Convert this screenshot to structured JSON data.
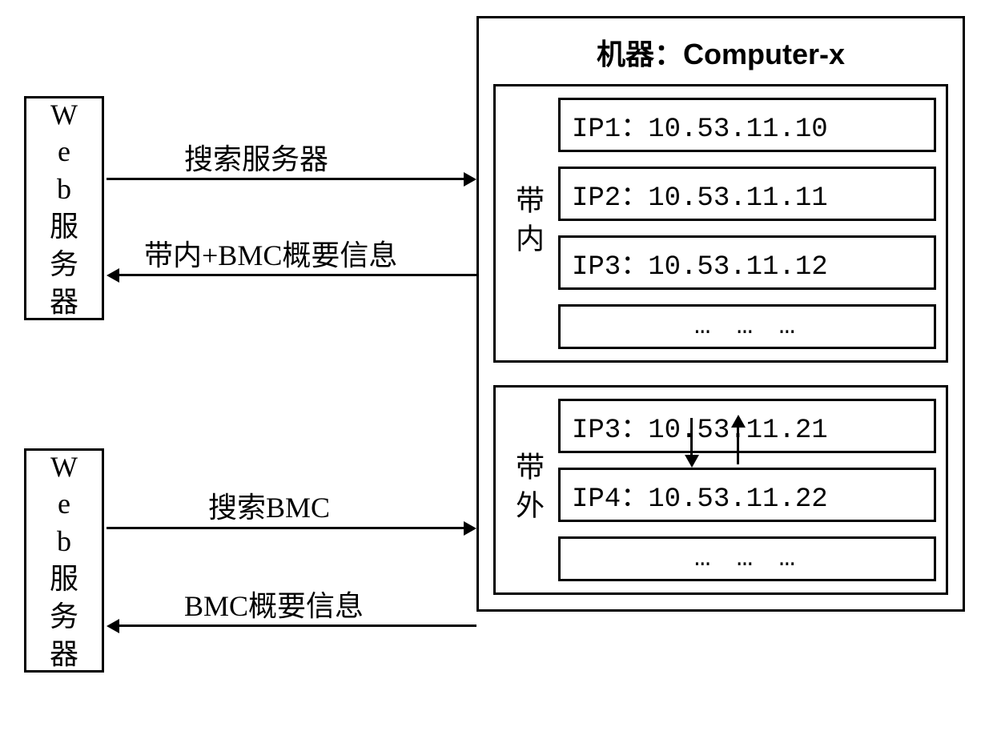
{
  "left": {
    "web_server_label": "Web服务器",
    "web_server_chars": [
      "W",
      "e",
      "b",
      "服",
      "务",
      "器"
    ]
  },
  "arrows": {
    "top_right_label": "搜索服务器",
    "top_left_label": "带内+BMC概要信息",
    "bottom_right_label": "搜索BMC",
    "bottom_left_label": "BMC概要信息"
  },
  "machine": {
    "title": "机器：Computer-x",
    "in_band": {
      "label": "带内",
      "items": [
        "IP1：10.53.11.10",
        "IP2：10.53.11.11",
        "IP3：10.53.11.12",
        "… … …"
      ]
    },
    "out_of_band": {
      "label": "带外",
      "items": [
        "IP3：10.53.11.21",
        "IP4：10.53.11.22",
        "… … …"
      ]
    }
  }
}
